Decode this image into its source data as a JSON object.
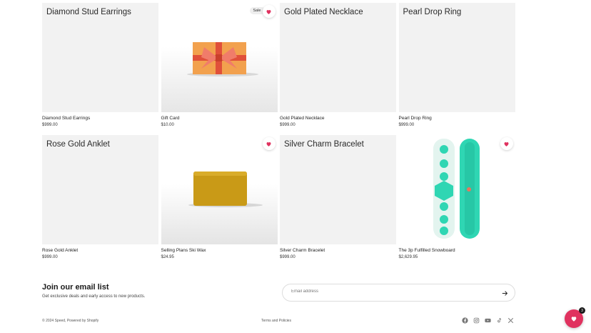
{
  "products": [
    {
      "name": "Diamond Stud Earrings",
      "price": "$999.00",
      "placeholder_title": "Diamond Stud Earrings",
      "image": "placeholder",
      "wishlisted": false
    },
    {
      "name": "Gift Card",
      "price": "$10.00",
      "image": "gift-card-image",
      "badge": "Sale",
      "wishlisted": true
    },
    {
      "name": "Gold Plated Necklace",
      "price": "$999.00",
      "placeholder_title": "Gold Plated Necklace",
      "image": "placeholder",
      "wishlisted": false
    },
    {
      "name": "Pearl Drop Ring",
      "price": "$999.00",
      "placeholder_title": "Pearl Drop Ring",
      "image": "placeholder",
      "wishlisted": false
    },
    {
      "name": "Rose Gold Anklet",
      "price": "$999.00",
      "placeholder_title": "Rose Gold Anklet",
      "image": "placeholder",
      "wishlisted": false
    },
    {
      "name": "Selling Plans Ski Wax",
      "price": "$24.95",
      "image": "ski-wax-image",
      "wishlisted": true
    },
    {
      "name": "Silver Charm Bracelet",
      "price": "$999.00",
      "placeholder_title": "Silver Charm Bracelet",
      "image": "placeholder",
      "wishlisted": false
    },
    {
      "name": "The 3p Fulfilled Snowboard",
      "price": "$2,629.95",
      "image": "snowboard-image",
      "wishlisted": true
    }
  ],
  "newsletter": {
    "heading": "Join our email list",
    "subtext": "Get exclusive deals and early access to new products.",
    "placeholder": "Email address"
  },
  "footer": {
    "copyright": "© 2024 Speed, Powered by Shopify",
    "policies_link": "Terms and Policies",
    "socials": [
      "facebook-icon",
      "instagram-icon",
      "youtube-icon",
      "tiktok-icon",
      "x-icon"
    ]
  },
  "wishlist_fab": {
    "count": "3"
  },
  "colors": {
    "accent": "#e0325f",
    "placeholder_bg": "#f2f2f2",
    "snowboard_teal": "#2fd6b3"
  }
}
